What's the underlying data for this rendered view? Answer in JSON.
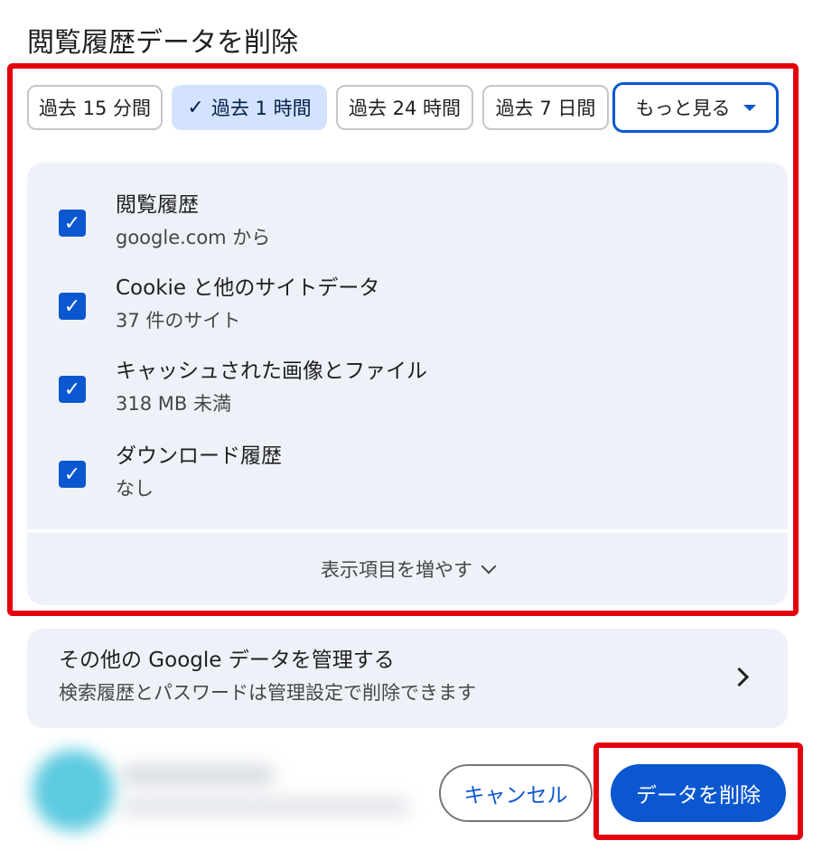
{
  "dialog": {
    "title": "閲覧履歴データを削除"
  },
  "time_range_chips": [
    {
      "label": "過去 15 分間",
      "selected": false
    },
    {
      "label": "過去 1 時間",
      "selected": true
    },
    {
      "label": "過去 24 時間",
      "selected": false
    },
    {
      "label": "過去 7 日間",
      "selected": false
    }
  ],
  "more_chip": {
    "label": "もっと見る",
    "icon": "dropdown-triangle-icon"
  },
  "options": [
    {
      "title": "閲覧履歴",
      "subtitle": "google.com から",
      "checked": true
    },
    {
      "title": "Cookie と他のサイトデータ",
      "subtitle": "37 件のサイト",
      "checked": true
    },
    {
      "title": "キャッシュされた画像とファイル",
      "subtitle": "318 MB 未満",
      "checked": true
    },
    {
      "title": "ダウンロード履歴",
      "subtitle": "なし",
      "checked": true
    }
  ],
  "expand": {
    "label": "表示項目を増やす",
    "icon": "chevron-down-icon"
  },
  "manage": {
    "title": "その他の Google データを管理する",
    "subtitle": "検索履歴とパスワードは管理設定で削除できます",
    "icon": "chevron-right-icon"
  },
  "buttons": {
    "cancel": "キャンセル",
    "delete": "データを削除"
  },
  "colors": {
    "accent": "#0b57d0",
    "selected_chip": "#d3e3fd",
    "panel": "#eef2f8",
    "highlight": "#e5000f"
  }
}
